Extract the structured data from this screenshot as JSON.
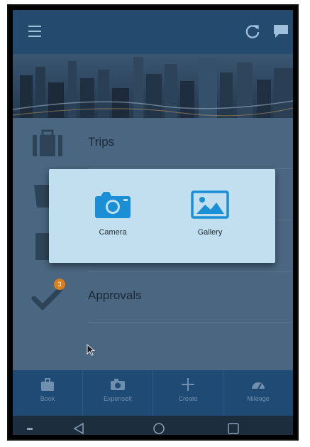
{
  "list": {
    "items": [
      {
        "label": "Trips",
        "icon": "suitcase-icon"
      },
      {
        "label": "",
        "icon": "receipt-icon"
      },
      {
        "label": "",
        "icon": "document-icon"
      },
      {
        "label": "Approvals",
        "icon": "checkmark-icon",
        "badge": "3"
      }
    ]
  },
  "dialog": {
    "options": [
      {
        "label": "Camera",
        "icon": "camera-icon"
      },
      {
        "label": "Gallery",
        "icon": "image-icon"
      }
    ]
  },
  "bottom_nav": {
    "tabs": [
      {
        "label": "Book",
        "icon": "briefcase-icon"
      },
      {
        "label": "ExpenseIt",
        "icon": "camera-icon"
      },
      {
        "label": "Create",
        "icon": "plus-icon"
      },
      {
        "label": "Mileage",
        "icon": "gauge-icon"
      }
    ]
  },
  "colors": {
    "appbar": "#244a6d",
    "dialog_bg": "#c2dff0",
    "dialog_icon": "#1a8fd6",
    "bottom_nav": "#1f4a73",
    "badge": "#d9801e"
  }
}
